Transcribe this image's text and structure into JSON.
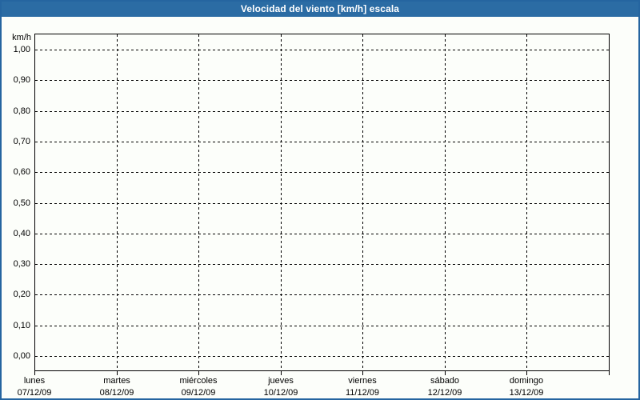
{
  "header": {
    "title": "Velocidad del viento [km/h] escala"
  },
  "chart_data": {
    "type": "line",
    "title": "Velocidad del viento [km/h] escala",
    "xlabel": "",
    "ylabel": "km/h",
    "ylim": [
      0.0,
      1.0
    ],
    "y_tick_step": 0.1,
    "y_tick_labels": [
      "1,00",
      "0,90",
      "0,80",
      "0,70",
      "0,60",
      "0,50",
      "0,40",
      "0,30",
      "0,20",
      "0,10",
      "0,00"
    ],
    "x_categories": [
      {
        "name": "lunes",
        "date": "07/12/09"
      },
      {
        "name": "martes",
        "date": "08/12/09"
      },
      {
        "name": "miércoles",
        "date": "09/12/09"
      },
      {
        "name": "jueves",
        "date": "10/12/09"
      },
      {
        "name": "viernes",
        "date": "11/12/09"
      },
      {
        "name": "sábado",
        "date": "12/12/09"
      },
      {
        "name": "domingo",
        "date": "13/12/09"
      }
    ],
    "series": [],
    "grid": "dashed-both-axes",
    "legend_position": "none",
    "plot_empty": true
  },
  "colors": {
    "header_background": "#2b6ca4",
    "header_text": "#ffffff",
    "page_border": "#2565a0",
    "background": "#fcfefa",
    "grid_line": "#000000",
    "axis_line": "#000000",
    "label_text": "#000000"
  }
}
